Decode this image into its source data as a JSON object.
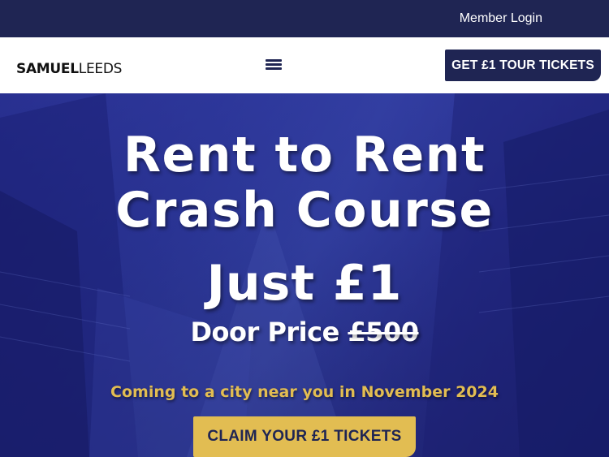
{
  "topbar": {
    "member_login": "Member Login"
  },
  "header": {
    "logo_bold": "SAMUEL",
    "logo_light": "LEEDS",
    "tour_button": "GET £1 TOUR TICKETS"
  },
  "hero": {
    "title_line1": "Rent to Rent",
    "title_line2": "Crash Course",
    "price": "Just £1",
    "door_price_label": "Door Price",
    "door_price_old": "£500",
    "coming": "Coming to a city near you in November 2024",
    "cta": "CLAIM YOUR £1 TICKETS"
  },
  "colors": {
    "navy": "#1f2553",
    "gold": "#e2bd52",
    "hero_blue": "#2f3ba0"
  },
  "icons": {
    "menu": "hamburger-menu-icon"
  }
}
